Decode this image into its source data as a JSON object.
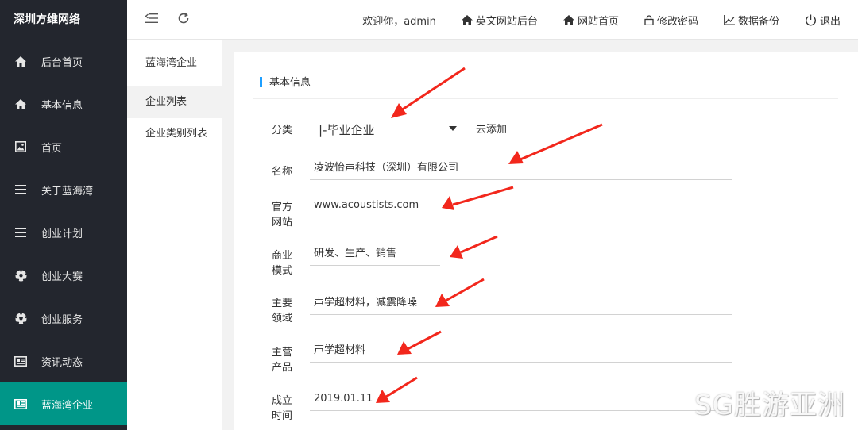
{
  "sidebar": {
    "brand": "深圳方维网络",
    "items": [
      {
        "label": "后台首页",
        "icon": "home-icon"
      },
      {
        "label": "基本信息",
        "icon": "home-icon"
      },
      {
        "label": "首页",
        "icon": "image-icon"
      },
      {
        "label": "关于蓝海湾",
        "icon": "menu-icon"
      },
      {
        "label": "创业计划",
        "icon": "menu-icon"
      },
      {
        "label": "创业大赛",
        "icon": "soccer-icon"
      },
      {
        "label": "创业服务",
        "icon": "soccer-icon"
      },
      {
        "label": "资讯动态",
        "icon": "newspaper-icon"
      },
      {
        "label": "蓝海湾企业",
        "icon": "newspaper-icon",
        "active": true
      }
    ],
    "active_color": "#009688"
  },
  "header": {
    "welcome": "欢迎你，admin",
    "links": [
      {
        "label": "英文网站后台",
        "icon": "home-icon"
      },
      {
        "label": "网站首页",
        "icon": "home-icon"
      },
      {
        "label": "修改密码",
        "icon": "lock-icon"
      },
      {
        "label": "数据备份",
        "icon": "chart-icon"
      },
      {
        "label": "退出",
        "icon": "power-icon"
      }
    ]
  },
  "submenu": {
    "title": "蓝海湾企业",
    "items": [
      "企业列表",
      "企业类别列表"
    ]
  },
  "form": {
    "section_title": "基本信息",
    "category": {
      "label": "分类",
      "value": "|-毕业企业",
      "add_link": "去添加"
    },
    "name": {
      "label": "名称",
      "value": "凌波怡声科技（深圳）有限公司"
    },
    "website": {
      "label": "官方网站",
      "value": "www.acoustists.com"
    },
    "business": {
      "label": "商业模式",
      "value": "研发、生产、销售"
    },
    "field": {
      "label": "主要领域",
      "value": "声学超材料，减震降噪"
    },
    "product": {
      "label": "主营产品",
      "value": "声学超材料"
    },
    "founded": {
      "label": "成立时间",
      "value": "2019.01.11"
    }
  },
  "watermark": "SG胜游亚洲"
}
